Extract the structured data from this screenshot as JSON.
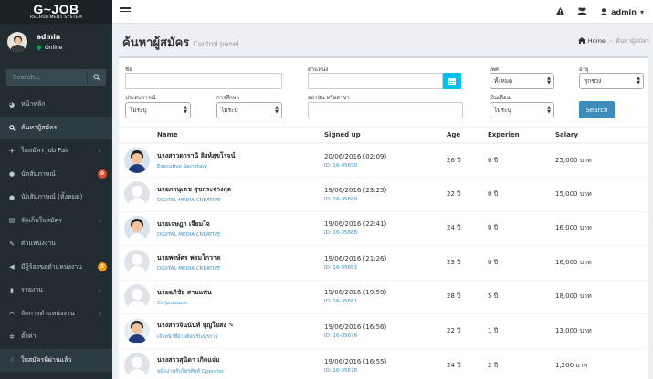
{
  "brand": {
    "logo_main": "G~JOB",
    "logo_sub": "RECRUITMENT SYSTEM"
  },
  "user": {
    "name": "admin",
    "status": "Online"
  },
  "sidebar": {
    "search_placeholder": "Search...",
    "items": [
      {
        "label": "หน้าหลัก",
        "icon": "dashboard-icon"
      },
      {
        "label": "ค้นหาผู้สมัคร",
        "icon": "search-icon",
        "active": true
      },
      {
        "label": "ใบสมัคร Job Fair",
        "icon": "plane-icon",
        "caret": true
      },
      {
        "label": "นัดสัมภาษณ์",
        "icon": "comments-icon",
        "badge": "0"
      },
      {
        "label": "นัดสัมภาษณ์ (ทั้งหมด)",
        "icon": "comments-icon"
      },
      {
        "label": "จัดเก็บใบสมัคร",
        "icon": "archive-icon",
        "caret": true
      },
      {
        "label": "ตำแหน่งงาน",
        "icon": "edit-icon"
      },
      {
        "label": "มีผู้ร้องขอตำแหน่งงาน",
        "icon": "bullhorn-icon",
        "badge": "5"
      },
      {
        "label": "รายงาน",
        "icon": "chart-icon",
        "caret": true
      },
      {
        "label": "จัดการตำแหน่งงาน",
        "icon": "wrench-icon",
        "caret": true
      },
      {
        "label": "ตั้งค่า",
        "icon": "gear-icon"
      },
      {
        "label": "ใบสมัครที่ผ่านแล้ว",
        "icon": "thumbs-up-icon"
      }
    ]
  },
  "topbar": {
    "admin_label": "admin"
  },
  "header": {
    "title": "ค้นหาผู้สมัคร",
    "subtitle": "Control panel",
    "breadcrumb_home": "Home",
    "breadcrumb_current": "ค้นหาผู้สมัคร"
  },
  "filters": {
    "name_label": "ชื่อ",
    "name_value": "",
    "position_label": "ตำแหน่ง",
    "position_value": "",
    "gender_label": "เพศ",
    "gender_value": "ทั้งหมด",
    "age_label": "อายุ",
    "age_value": "ทุกช่วง",
    "experience_label": "ประสบการณ์",
    "experience_value": "ไม่ระบุ",
    "education_label": "การศึกษา",
    "education_value": "ไม่ระบุ",
    "institution_label": "สถาบัน หรือสาขา",
    "institution_value": "",
    "salary_label": "เงินเดือน",
    "salary_value": "ไม่ระบุ",
    "search_button": "Search"
  },
  "table": {
    "columns": {
      "name": "Name",
      "signed_up": "Signed up",
      "age": "Age",
      "experience": "Experien",
      "salary": "Salary"
    },
    "rows": [
      {
        "photo": "real-female",
        "name": "นางสาวดารานี ลิงห์สุขโรจน์",
        "position": "Executive Secretary",
        "signed": "20/06/2016 (02:09)",
        "id": "ID: 16-05690",
        "age": "26 ปี",
        "exp": "0 ปี",
        "salary": "25,000 บาท"
      },
      {
        "photo": "placeholder",
        "name": "นายภานุเดช สุขกระจ่างกุล",
        "position": "DIGITAL MEDIA CREATIVE",
        "signed": "19/06/2016 (23:25)",
        "id": "ID: 16-05689",
        "age": "22 ปี",
        "exp": "0 ปี",
        "salary": "15,000 บาท"
      },
      {
        "photo": "real-male",
        "name": "นายเจษฎา เจียมใจ",
        "position": "DIGITAL MEDIA CREATIVE",
        "signed": "19/06/2016 (22:41)",
        "id": "ID: 16-05688",
        "age": "24 ปี",
        "exp": "0 ปี",
        "salary": "16,000 บาท"
      },
      {
        "photo": "placeholder",
        "name": "นายพงษ์ศร พรมโกวาด",
        "position": "DIGITAL MEDIA CREATIVE",
        "signed": "19/06/2016 (21:26)",
        "id": "ID: 16-05683",
        "age": "23 ปี",
        "exp": "0 ปี",
        "salary": "16,000 บาท"
      },
      {
        "photo": "placeholder",
        "name": "นายอภิชัย สามแท่น",
        "position": "Co-producer",
        "signed": "19/06/2016 (19:59)",
        "id": "ID: 16-05681",
        "age": "28 ปี",
        "exp": "5 ปี",
        "salary": "18,000 บาท"
      },
      {
        "photo": "real-female-2",
        "name": "นางสาวจินนันท์ บุญโยสง ✎",
        "position": "เจ้าหน้าที่ฝ่ายต้อนรับ/ธุรการ",
        "signed": "19/06/2016 (16:56)",
        "id": "ID: 16-05679",
        "age": "22 ปี",
        "exp": "1 ปี",
        "salary": "13,000 บาท"
      },
      {
        "photo": "placeholder",
        "name": "นางสาวสุนิดา เกิดแจ่ม",
        "position": "พนักงานรับโทรศัพท์ Operator",
        "signed": "19/06/2016 (16:55)",
        "id": "ID: 16-05678",
        "age": "24 ปี",
        "exp": "2 ปี",
        "salary": "1,200 บาท"
      }
    ]
  }
}
